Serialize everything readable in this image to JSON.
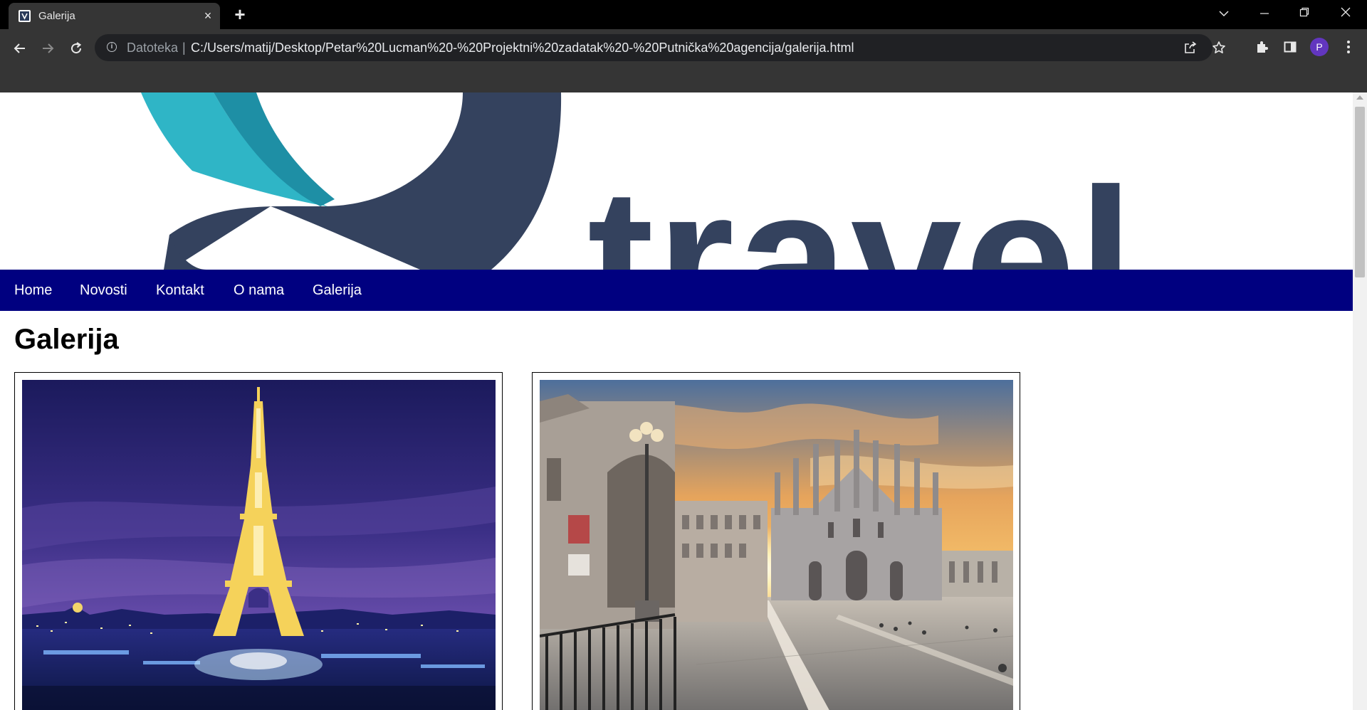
{
  "browser": {
    "tab_title": "Galerija",
    "tab_close": "×",
    "new_tab": "+",
    "address_scheme_label": "Datoteka",
    "address_separator": "|",
    "address_url": "C:/Users/matij/Desktop/Petar%20Lucman%20-%20Projektni%20zadatak%20-%20Putnička%20agencija/galerija.html",
    "profile_initial": "P"
  },
  "banner": {
    "logo_text": "travel"
  },
  "nav": {
    "items": [
      {
        "label": "Home"
      },
      {
        "label": "Novosti"
      },
      {
        "label": "Kontakt"
      },
      {
        "label": "O nama"
      },
      {
        "label": "Galerija"
      }
    ]
  },
  "page": {
    "heading": "Galerija"
  },
  "gallery": {
    "images": [
      {
        "subject": "Eiffel tower at night"
      },
      {
        "subject": "Milan cathedral square at sunset"
      }
    ]
  },
  "colors": {
    "nav_background": "#000080",
    "logo_dark": "#34425e",
    "logo_teal": "#2fb5c6"
  }
}
